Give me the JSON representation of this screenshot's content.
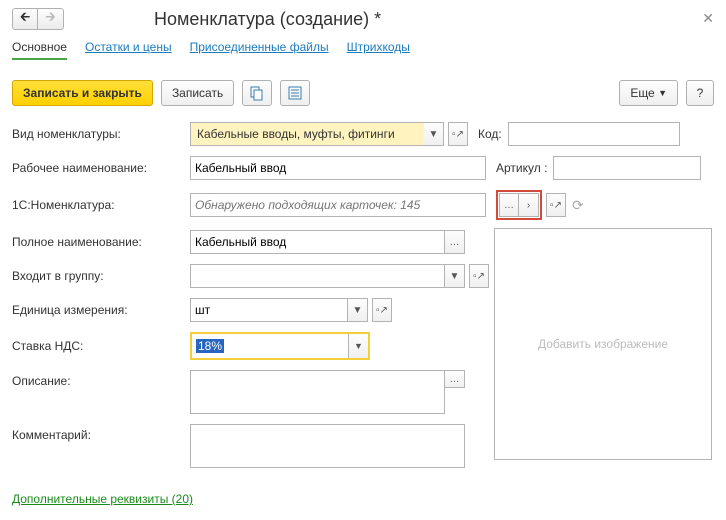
{
  "header": {
    "title": "Номенклатура (создание) *"
  },
  "tabs": {
    "main": "Основное",
    "balances": "Остатки и цены",
    "files": "Присоединенные файлы",
    "barcodes": "Штрихкоды"
  },
  "toolbar": {
    "save_close": "Записать и закрыть",
    "save": "Записать",
    "more": "Еще",
    "help": "?"
  },
  "labels": {
    "type": "Вид номенклатуры:",
    "work_name": "Рабочее наименование:",
    "one_c": "1С:Номенклатура:",
    "full_name": "Полное наименование:",
    "group": "Входит в группу:",
    "unit": "Единица измерения:",
    "vat": "Ставка НДС:",
    "desc": "Описание:",
    "comment": "Комментарий:",
    "code": "Код:",
    "article": "Артикул :"
  },
  "values": {
    "type": "Кабельные вводы, муфты, фитинги",
    "work_name": "Кабельный ввод",
    "one_c_placeholder": "Обнаружено подходящих карточек: 145",
    "full_name": "Кабельный ввод",
    "group": "",
    "unit": "шт",
    "vat": "18%",
    "desc": "",
    "comment": "",
    "code": "",
    "article": "",
    "image_hint": "Добавить изображение"
  },
  "footer": {
    "extra": "Дополнительные реквизиты (20)"
  }
}
